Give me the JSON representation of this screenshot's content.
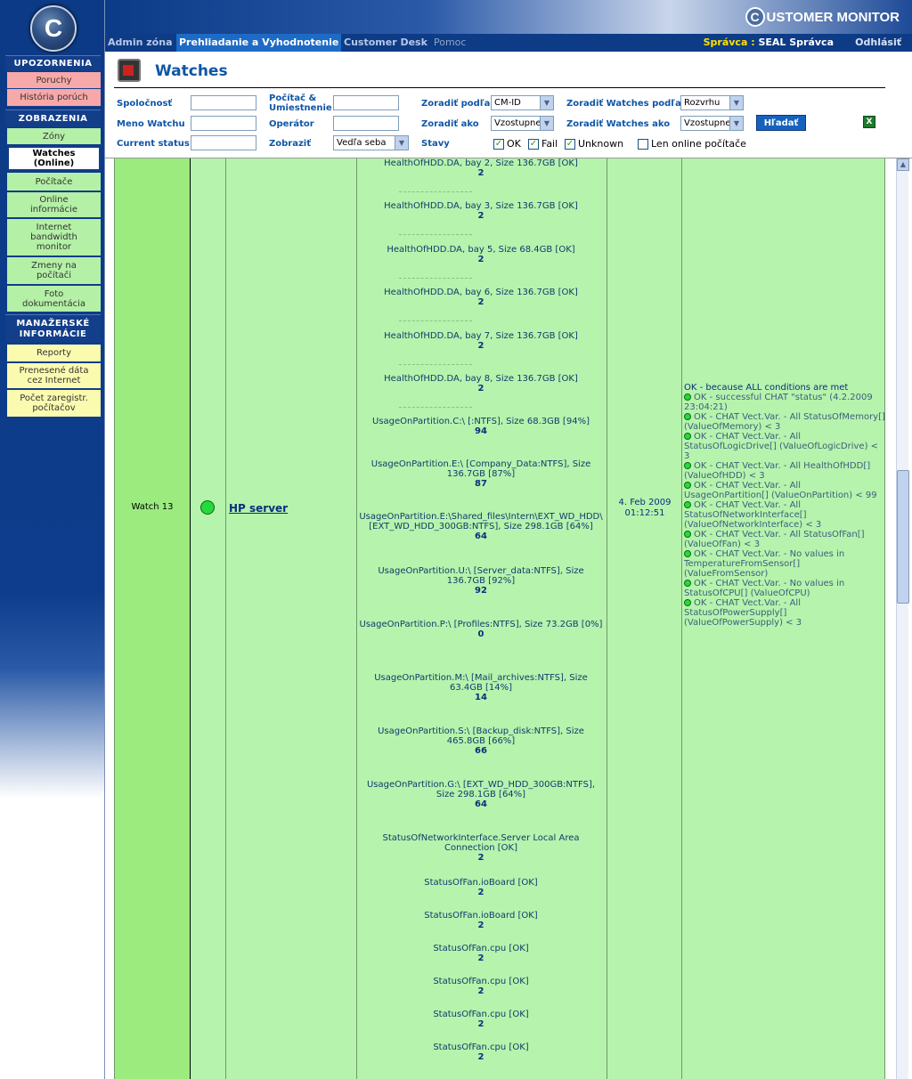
{
  "sidebar": {
    "logo_letter": "C",
    "sections": [
      {
        "title": "UPOZORNENIA"
      },
      {
        "title": "ZOBRAZENIA"
      },
      {
        "title": "MANAŽERSKÉ INFORMÁCIE"
      }
    ],
    "alerts": [
      "Poruchy",
      "História porúch"
    ],
    "views": [
      "Zóny",
      "Watches (Online)",
      "Počítače",
      "Online informácie",
      "Internet bandwidth monitor",
      "Zmeny na počítači",
      "Foto dokumentácia"
    ],
    "management": [
      "Reporty",
      "Prenesené dáta cez Internet",
      "Počet zaregistr. počítačov"
    ]
  },
  "brand": {
    "letter": "C",
    "text": "USTOMER MONITOR"
  },
  "menu": {
    "items": [
      "Admin zóna",
      "Prehliadanie a Vyhodnotenie",
      "Customer Desk",
      "Pomoc"
    ],
    "user_label": "Správca :",
    "user_name": "SEAL Správca",
    "logout": "Odhlásiť"
  },
  "page_title": "Watches",
  "filters": {
    "company_label": "Spoločnosť",
    "watch_name_label": "Meno Watchu",
    "current_status_label": "Current status",
    "computer_label": "Počítač & Umiestnenie",
    "operator_label": "Operátor",
    "display_label": "Zobraziť",
    "display_value": "Vedľa seba",
    "sort_by_label": "Zoradiť podľa",
    "sort_by_value": "CM-ID",
    "sort_as_label": "Zoradiť ako",
    "sort_as_value": "Vzostupne",
    "states_label": "Stavy",
    "sort_watches_by_label": "Zoradiť Watches podľa",
    "sort_watches_by_value": "Rozvrhu",
    "sort_watches_as_label": "Zoradiť Watches ako",
    "sort_watches_as_value": "Vzostupne",
    "search_button": "Hľadať",
    "excel_icon_letter": "X",
    "checks": [
      {
        "label": "OK",
        "checked": true
      },
      {
        "label": "Fail",
        "checked": true
      },
      {
        "label": "Unknown",
        "checked": true
      },
      {
        "label": "Len online počítače",
        "checked": false
      }
    ]
  },
  "row": {
    "watch_name": "Watch 13",
    "computer": "HP server",
    "date": "4. Feb 2009",
    "time": "01:12:51",
    "values": [
      {
        "label": "HealthOfHDD.DA, bay 2, Size 136.7GB [OK]",
        "n": "2"
      },
      {
        "label": "HealthOfHDD.DA, bay 3, Size 136.7GB [OK]",
        "n": "2"
      },
      {
        "label": "HealthOfHDD.DA, bay 5, Size 68.4GB [OK]",
        "n": "2"
      },
      {
        "label": "HealthOfHDD.DA, bay 6, Size 136.7GB [OK]",
        "n": "2"
      },
      {
        "label": "HealthOfHDD.DA, bay 7, Size 136.7GB [OK]",
        "n": "2"
      },
      {
        "label": "HealthOfHDD.DA, bay 8, Size 136.7GB [OK]",
        "n": "2"
      },
      {
        "label": "UsageOnPartition.C:\\ [:NTFS], Size 68.3GB [94%]",
        "n": "94"
      },
      {
        "label": "UsageOnPartition.E:\\ [Company_Data:NTFS], Size 136.7GB [87%]",
        "n": "87"
      },
      {
        "label": "UsageOnPartition.E:\\Shared_files\\Intern\\EXT_WD_HDD\\ [EXT_WD_HDD_300GB:NTFS], Size 298.1GB [64%]",
        "n": "64"
      },
      {
        "label": "UsageOnPartition.U:\\ [Server_data:NTFS], Size 136.7GB [92%]",
        "n": "92"
      },
      {
        "label": "UsageOnPartition.P:\\ [Profiles:NTFS], Size 73.2GB [0%]",
        "n": "0"
      },
      {
        "label": "UsageOnPartition.M:\\ [Mail_archives:NTFS], Size 63.4GB [14%]",
        "n": "14"
      },
      {
        "label": "UsageOnPartition.S:\\ [Backup_disk:NTFS], Size 465.8GB [66%]",
        "n": "66"
      },
      {
        "label": "UsageOnPartition.G:\\ [EXT_WD_HDD_300GB:NTFS], Size 298.1GB [64%]",
        "n": "64"
      },
      {
        "label": "StatusOfNetworkInterface.Server Local Area Connection [OK]",
        "n": "2"
      },
      {
        "label": "StatusOfFan.ioBoard [OK]",
        "n": "2"
      },
      {
        "label": "StatusOfFan.ioBoard [OK]",
        "n": "2"
      },
      {
        "label": "StatusOfFan.cpu [OK]",
        "n": "2"
      },
      {
        "label": "StatusOfFan.cpu [OK]",
        "n": "2"
      },
      {
        "label": "StatusOfFan.cpu [OK]",
        "n": "2"
      },
      {
        "label": "StatusOfFan.cpu [OK]",
        "n": "2"
      }
    ],
    "result_header": "OK - because ALL conditions are met",
    "result_lines": [
      "OK - successful CHAT \"status\" (4.2.2009 23:04:21)",
      "OK - CHAT Vect.Var. - All StatusOfMemory[] (ValueOfMemory) < 3",
      "OK - CHAT Vect.Var. - All StatusOfLogicDrive[] (ValueOfLogicDrive) < 3",
      "OK - CHAT Vect.Var. - All HealthOfHDD[] (ValueOfHDD) < 3",
      "OK - CHAT Vect.Var. - All UsageOnPartition[] (ValueOnPartition) < 99",
      "OK - CHAT Vect.Var. - All StatusOfNetworkInterface[] (ValueOfNetworkInterface) < 3",
      "OK - CHAT Vect.Var. - All StatusOfFan[] (ValueOfFan) < 3",
      "OK - CHAT Vect.Var. - No values in TemperatureFromSensor[] (ValueFromSensor)",
      "OK - CHAT Vect.Var. - No values in StatusOfCPU[] (ValueOfCPU)",
      "OK - CHAT Vect.Var. - All StatusOfPowerSupply[] (ValueOfPowerSupply) < 3"
    ]
  },
  "colors": {
    "row_bg": "#b6f3ad",
    "accent": "#0f56a6",
    "nav": "#0d3b86"
  }
}
